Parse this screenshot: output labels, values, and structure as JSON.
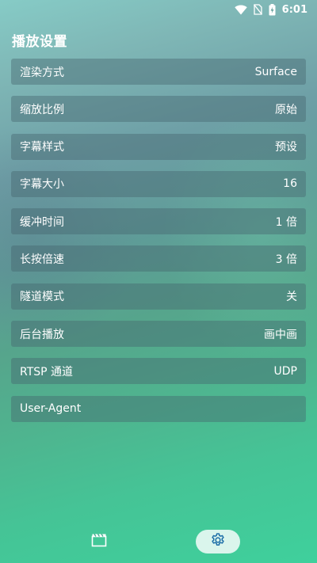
{
  "status_bar": {
    "time": "6:01",
    "icons": [
      "wifi-icon",
      "no-sim-icon",
      "battery-charging-icon"
    ]
  },
  "page": {
    "title": "播放设置"
  },
  "settings": [
    {
      "label": "渲染方式",
      "value": "Surface"
    },
    {
      "label": "缩放比例",
      "value": "原始"
    },
    {
      "label": "字幕样式",
      "value": "预设"
    },
    {
      "label": "字幕大小",
      "value": "16"
    },
    {
      "label": "缓冲时间",
      "value": "1 倍"
    },
    {
      "label": "长按倍速",
      "value": "3 倍"
    },
    {
      "label": "隧道模式",
      "value": "关"
    },
    {
      "label": "后台播放",
      "value": "画中画"
    },
    {
      "label": "RTSP 通道",
      "value": "UDP"
    },
    {
      "label": "User-Agent",
      "value": ""
    }
  ],
  "bottom_nav": {
    "items": [
      {
        "icon": "clapperboard-icon",
        "selected": false
      },
      {
        "icon": "gear-icon",
        "selected": true
      }
    ],
    "accent_color": "#1e6fa8"
  }
}
